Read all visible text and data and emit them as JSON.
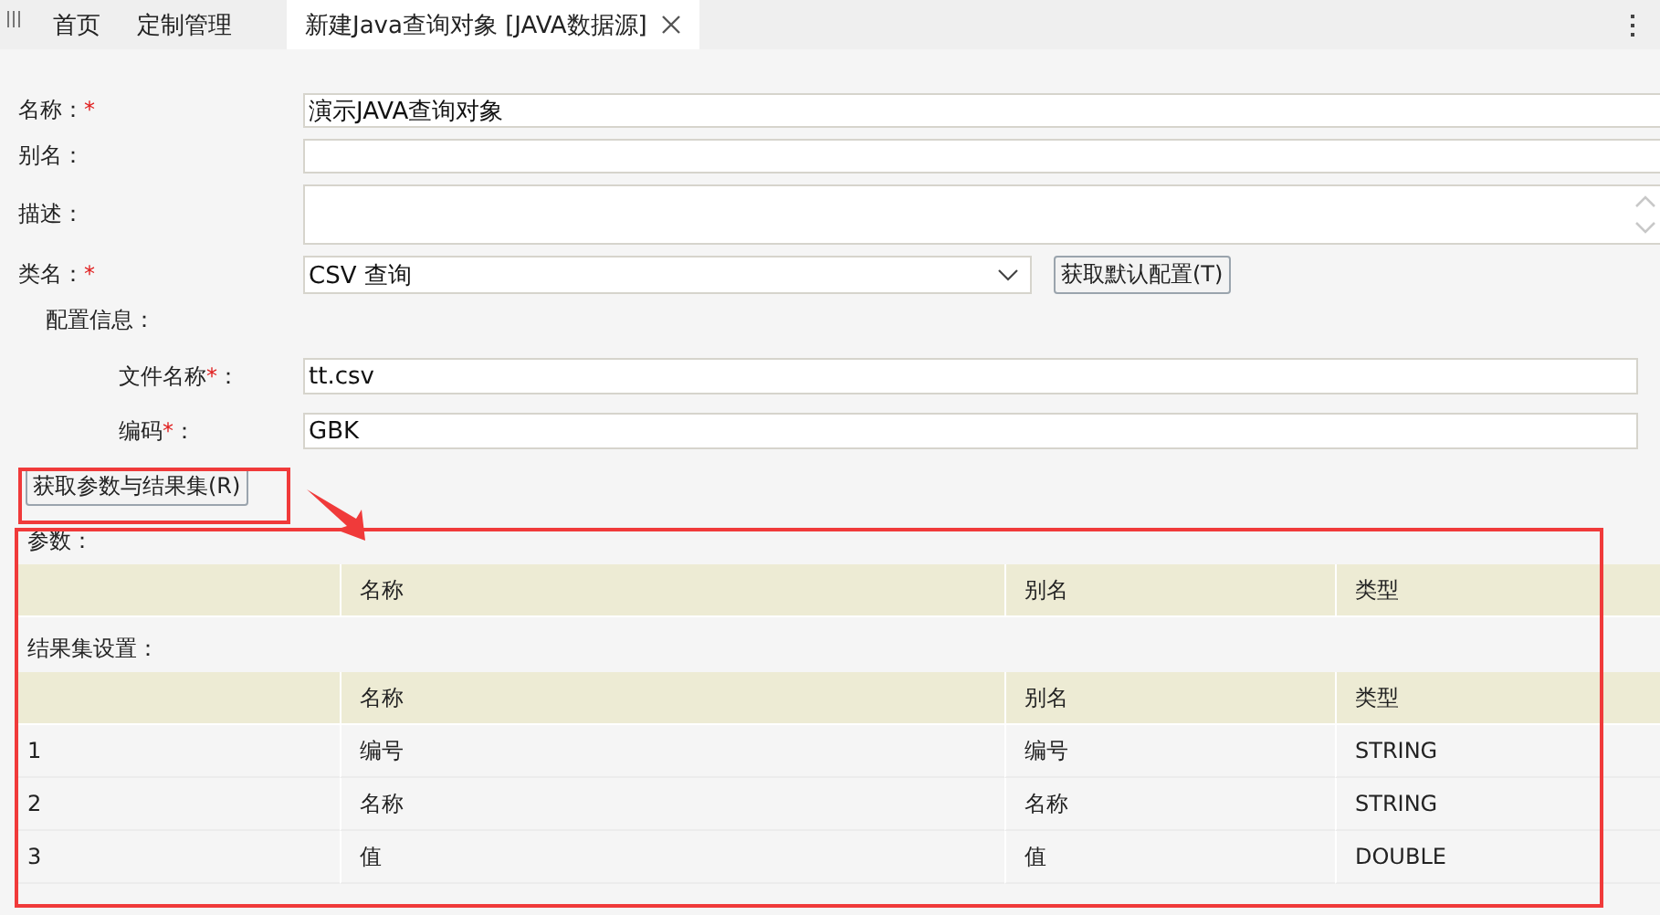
{
  "tabs": [
    {
      "label": "首页",
      "selected": false,
      "closable": false
    },
    {
      "label": "定制管理",
      "selected": false,
      "closable": false
    },
    {
      "label": "新建Java查询对象 [JAVA数据源]",
      "selected": true,
      "closable": true
    }
  ],
  "form": {
    "fields": [
      {
        "kind": "text",
        "label": "名称：",
        "required_mark": "*",
        "value": "演示JAVA查询对象"
      },
      {
        "kind": "text",
        "label": "别名："
      },
      {
        "kind": "textarea",
        "label": "描述："
      },
      {
        "kind": "select",
        "label": "类名：",
        "required_mark": "*",
        "value": "CSV 查询",
        "button": "获取默认配置(T)"
      }
    ],
    "config": {
      "title": "配置信息：",
      "fields": [
        {
          "kind": "text",
          "label": "文件名称",
          "required_mark": "*",
          "colon": "：",
          "value": "tt.csv"
        },
        {
          "kind": "text",
          "label": "编码",
          "required_mark": "*",
          "colon": "：",
          "value": "GBK"
        }
      ]
    },
    "fetch_button": "获取参数与结果集(R)"
  },
  "params": {
    "title": "参数：",
    "columns": [
      "",
      "名称",
      "别名",
      "类型"
    ]
  },
  "results": {
    "title": "结果集设置：",
    "columns": [
      "",
      "名称",
      "别名",
      "类型"
    ],
    "rows": [
      [
        "1",
        "编号",
        "编号",
        "STRING"
      ],
      [
        "2",
        "名称",
        "名称",
        "STRING"
      ],
      [
        "3",
        "值",
        "值",
        "DOUBLE"
      ]
    ]
  }
}
